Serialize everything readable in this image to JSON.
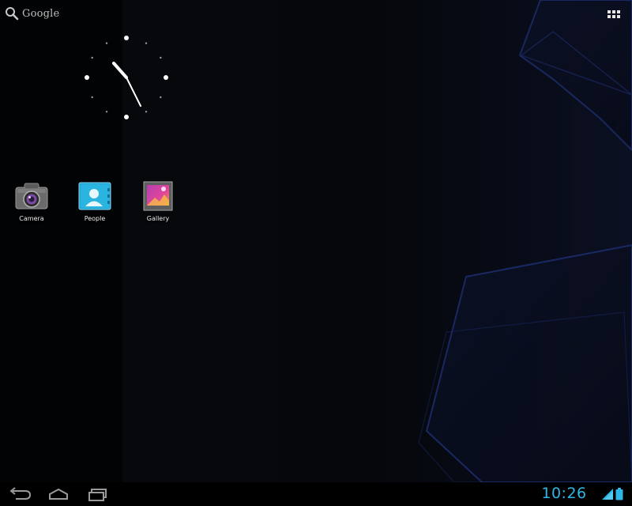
{
  "search": {
    "label": "Google",
    "icon": "search-icon"
  },
  "all_apps": {
    "icon": "all-apps-grid-icon"
  },
  "clock_widget": {
    "type": "analog",
    "time": "10:26"
  },
  "apps": [
    {
      "label": "Camera",
      "icon": "camera-icon"
    },
    {
      "label": "People",
      "icon": "people-icon"
    },
    {
      "label": "Gallery",
      "icon": "gallery-icon"
    }
  ],
  "system_bar": {
    "time": "10:26",
    "back_icon": "back-icon",
    "home_icon": "home-icon",
    "recent_icon": "recent-apps-icon",
    "signal_icon": "wifi-signal-icon",
    "battery_icon": "battery-icon"
  },
  "colors": {
    "accent": "#2fb6e6",
    "wallpaper_line": "#1c2c6a"
  }
}
